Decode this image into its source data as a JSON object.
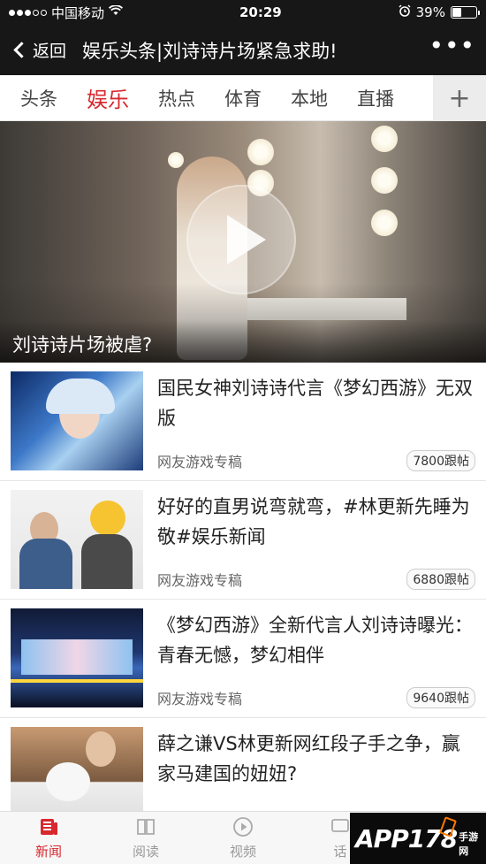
{
  "status": {
    "carrier": "中国移动",
    "time": "20:29",
    "battery_text": "39%",
    "battery_level": 0.39
  },
  "nav": {
    "back_label": "返回",
    "title": "娱乐头条|刘诗诗片场紧急求助!",
    "more_label": "•••"
  },
  "tabs": [
    {
      "label": "头条",
      "active": false
    },
    {
      "label": "娱乐",
      "active": true
    },
    {
      "label": "热点",
      "active": false
    },
    {
      "label": "体育",
      "active": false
    },
    {
      "label": "本地",
      "active": false
    },
    {
      "label": "直播",
      "active": false
    }
  ],
  "tab_add_label": "+",
  "hero": {
    "caption": "刘诗诗片场被虐?",
    "play_icon": "play-icon"
  },
  "news": [
    {
      "title": "国民女神刘诗诗代言《梦幻西游》无双版",
      "source": "网友游戏专稿",
      "count": "7800跟帖"
    },
    {
      "title": "好好的直男说弯就弯，#林更新先睡为敬#娱乐新闻",
      "source": "网友游戏专稿",
      "count": "6880跟帖"
    },
    {
      "title": "《梦幻西游》全新代言人刘诗诗曝光：青春无憾，梦幻相伴",
      "source": "网友游戏专稿",
      "count": "9640跟帖"
    },
    {
      "title": "薛之谦VS林更新网红段子手之争，赢家马建国的妞妞?",
      "source": "",
      "count": ""
    }
  ],
  "bottom_tabs": [
    {
      "label": "新闻",
      "icon": "newspaper-icon",
      "active": true
    },
    {
      "label": "阅读",
      "icon": "book-icon",
      "active": false
    },
    {
      "label": "视频",
      "icon": "play-circle-icon",
      "active": false
    },
    {
      "label": "话",
      "icon": "chat-icon",
      "active": false
    }
  ],
  "watermark": {
    "text": "APP178",
    "sub": "手游网"
  },
  "colors": {
    "accent": "#d8282f",
    "bar": "#171717"
  }
}
